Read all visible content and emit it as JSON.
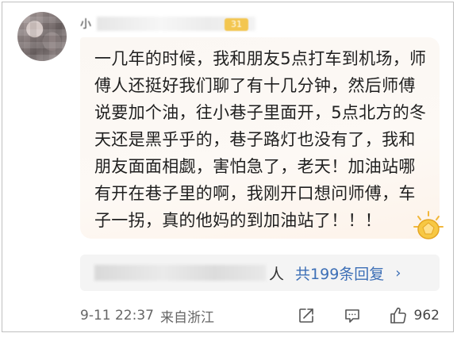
{
  "comment": {
    "username": "小",
    "level_badge": "31",
    "text": "一几年的时候，我和朋友5点打车到机场，师傅人还挺好我们聊了有十几分钟，然后师傅说要加个油，往小巷子里面开，5点北方的冬天还是黑乎乎的，巷子路灯也没有了，我和朋友面面相觑，害怕急了，老天！加油站哪有开在巷子里的啊，我刚开口想问师傅，车子一拐，真的他妈的到加油站了！！！"
  },
  "replies": {
    "suffix": "人",
    "link_label": "共199条回复",
    "chevron": "›"
  },
  "meta": {
    "time": "9-11 22:37",
    "source": "来自浙江",
    "like_count": "962"
  },
  "icons": {
    "share": "share-icon",
    "comment": "comment-icon",
    "like": "thumbs-up-icon",
    "sticker": "gold-badge-sticker-icon"
  },
  "colors": {
    "link": "#3d6fb6",
    "badge": "#f3c650",
    "bubble": "#fbf7f3"
  }
}
